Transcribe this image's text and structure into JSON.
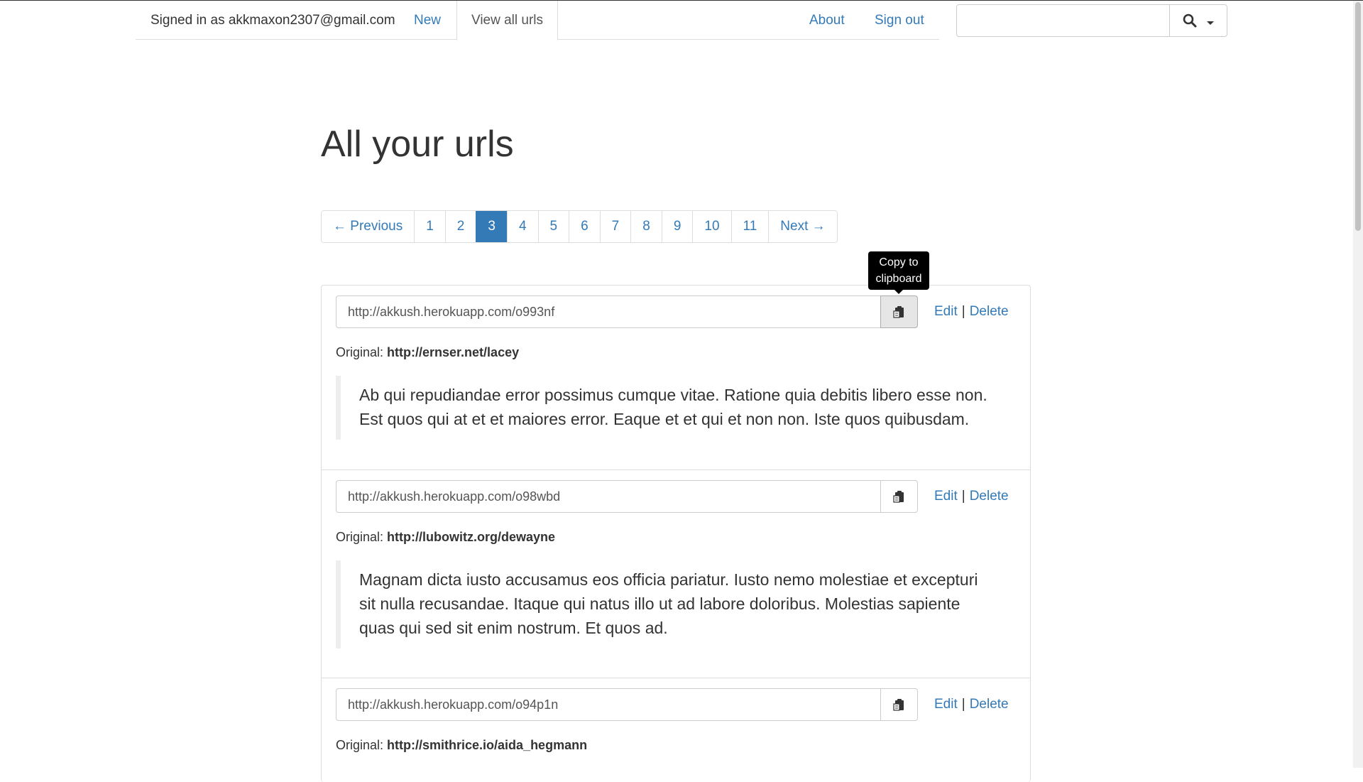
{
  "nav": {
    "signed_in_text": "Signed in as akkmaxon2307@gmail.com",
    "new_label": "New",
    "view_all_label": "View all urls",
    "about_label": "About",
    "signout_label": "Sign out"
  },
  "search": {
    "value": "",
    "placeholder": ""
  },
  "page_title": "All your urls",
  "pagination": {
    "previous": "← Previous",
    "next": "Next →",
    "pages": [
      "1",
      "2",
      "3",
      "4",
      "5",
      "6",
      "7",
      "8",
      "9",
      "10",
      "11"
    ],
    "active": "3"
  },
  "tooltip": {
    "line1": "Copy to",
    "line2": "clipboard"
  },
  "urls": [
    {
      "short_url": "http://akkush.herokuapp.com/o993nf",
      "original_prefix": "Original: ",
      "original": "http://ernser.net/lacey",
      "description": "Ab qui repudiandae error possimus cumque vitae. Ratione quia debitis libero esse non. Est quos qui at et et maiores error. Eaque et et qui et non non. Iste quos quibusdam.",
      "edit": "Edit",
      "sep": "|",
      "delete": "Delete"
    },
    {
      "short_url": "http://akkush.herokuapp.com/o98wbd",
      "original_prefix": "Original: ",
      "original": "http://lubowitz.org/dewayne",
      "description": "Magnam dicta iusto accusamus eos officia pariatur. Iusto nemo molestiae et excepturi sit nulla recusandae. Itaque qui natus illo ut ad labore doloribus. Molestias sapiente quas qui sed sit enim nostrum. Et quos ad.",
      "edit": "Edit",
      "sep": "|",
      "delete": "Delete"
    },
    {
      "short_url": "http://akkush.herokuapp.com/o94p1n",
      "original_prefix": "Original: ",
      "original": "http://smithrice.io/aida_hegmann",
      "edit": "Edit",
      "sep": "|",
      "delete": "Delete"
    }
  ],
  "icons": {
    "search": "search-icon",
    "caret": "caret-down-icon",
    "clipboard": "clipboard-icon"
  }
}
